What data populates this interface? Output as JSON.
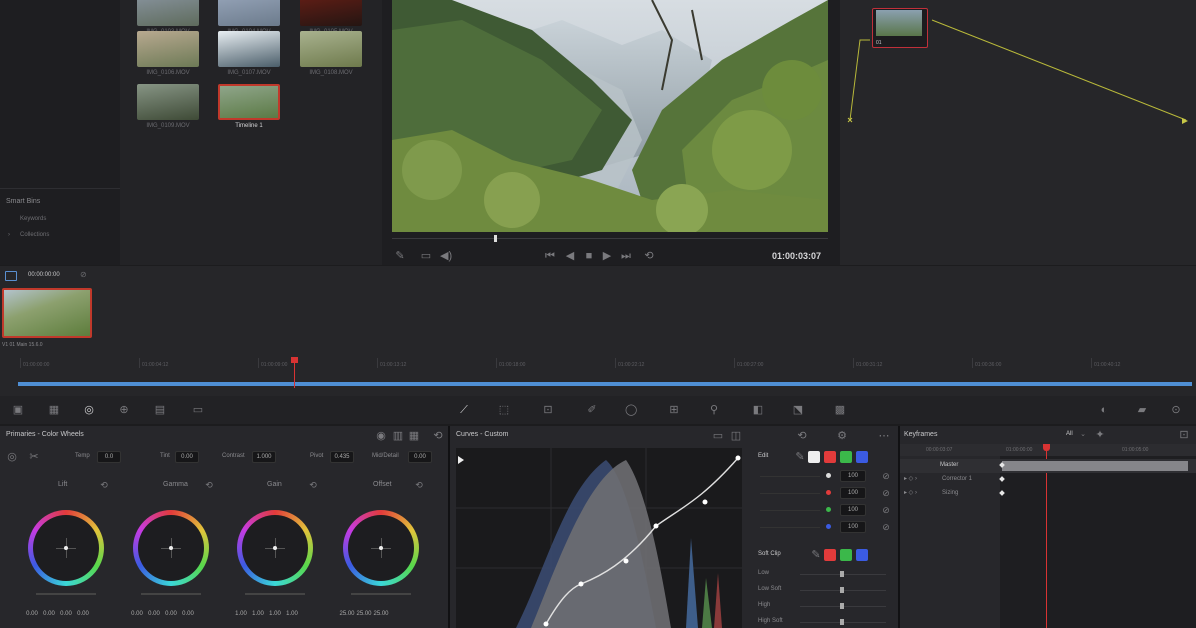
{
  "media_pool": {
    "clips": [
      {
        "label": "IMG_0103.MOV",
        "colors": [
          "#8c97a4",
          "#5e6b5c"
        ]
      },
      {
        "label": "IMG_0104.MOV",
        "colors": [
          "#9aa8bd",
          "#6c7b8c"
        ]
      },
      {
        "label": "IMG_0105.MOV",
        "colors": [
          "#6a1f16",
          "#241512"
        ]
      },
      {
        "label": "IMG_0106.MOV",
        "colors": [
          "#b8a990",
          "#6d7a56"
        ]
      },
      {
        "label": "IMG_0107.MOV",
        "colors": [
          "#e8eef2",
          "#4b5e6a"
        ]
      },
      {
        "label": "IMG_0108.MOV",
        "colors": [
          "#a9b28f",
          "#6e7a4c"
        ]
      },
      {
        "label": "IMG_0109.MOV",
        "colors": [
          "#879585",
          "#3e4a36"
        ]
      },
      {
        "label": "Timeline 1",
        "colors": [
          "#8fa58a",
          "#5b7a45"
        ],
        "selected": true
      }
    ],
    "smart_bins": {
      "title": "Smart Bins",
      "items": [
        "Keywords",
        "Collections"
      ]
    }
  },
  "viewer": {
    "timecode": "01:00:03:07"
  },
  "node_label": "01",
  "timeline": {
    "clip_timecode": "00:00:00:00",
    "clip_label": "V1 01 Main 15.6.0",
    "ruler": [
      "01:00:00:00",
      "01:00:04:12",
      "01:00:09:00",
      "01:00:13:12",
      "01:00:18:00",
      "01:00:22:12",
      "01:00:27:00",
      "01:00:31:12",
      "01:00:36:00",
      "01:00:40:12"
    ]
  },
  "primaries": {
    "title": "Primaries - Color Wheels",
    "params": [
      {
        "label": "Temp",
        "value": "0.0"
      },
      {
        "label": "Tint",
        "value": "0.00"
      },
      {
        "label": "Contrast",
        "value": "1.000"
      },
      {
        "label": "Pivot",
        "value": "0.435"
      },
      {
        "label": "Mid/Detail",
        "value": "0.00"
      }
    ],
    "wheels": [
      {
        "name": "Lift",
        "values": [
          "0.00",
          "0.00",
          "0.00",
          "0.00"
        ]
      },
      {
        "name": "Gamma",
        "values": [
          "0.00",
          "0.00",
          "0.00",
          "0.00"
        ]
      },
      {
        "name": "Gain",
        "values": [
          "1.00",
          "1.00",
          "1.00",
          "1.00"
        ]
      },
      {
        "name": "Offset",
        "values": [
          "25.00",
          "25.00",
          "25.00"
        ]
      }
    ]
  },
  "curves": {
    "title": "Curves - Custom",
    "edit_label": "Edit",
    "edit_values": [
      "100",
      "100",
      "100",
      "100"
    ],
    "softclip_title": "Soft Clip",
    "softclip_rows": [
      "Low",
      "Low Soft",
      "High",
      "High Soft"
    ]
  },
  "keyframes": {
    "title": "Keyframes",
    "mode": "All",
    "ruler": [
      "00:00:03:07",
      "01:00:00:00",
      "01:00:05:00"
    ],
    "rows": [
      "Master",
      "Corrector 1",
      "Sizing"
    ]
  },
  "colors": {
    "accent_red": "#e23b3b",
    "timeline_blue": "#4f8fd4",
    "playhead": "#d83333"
  }
}
